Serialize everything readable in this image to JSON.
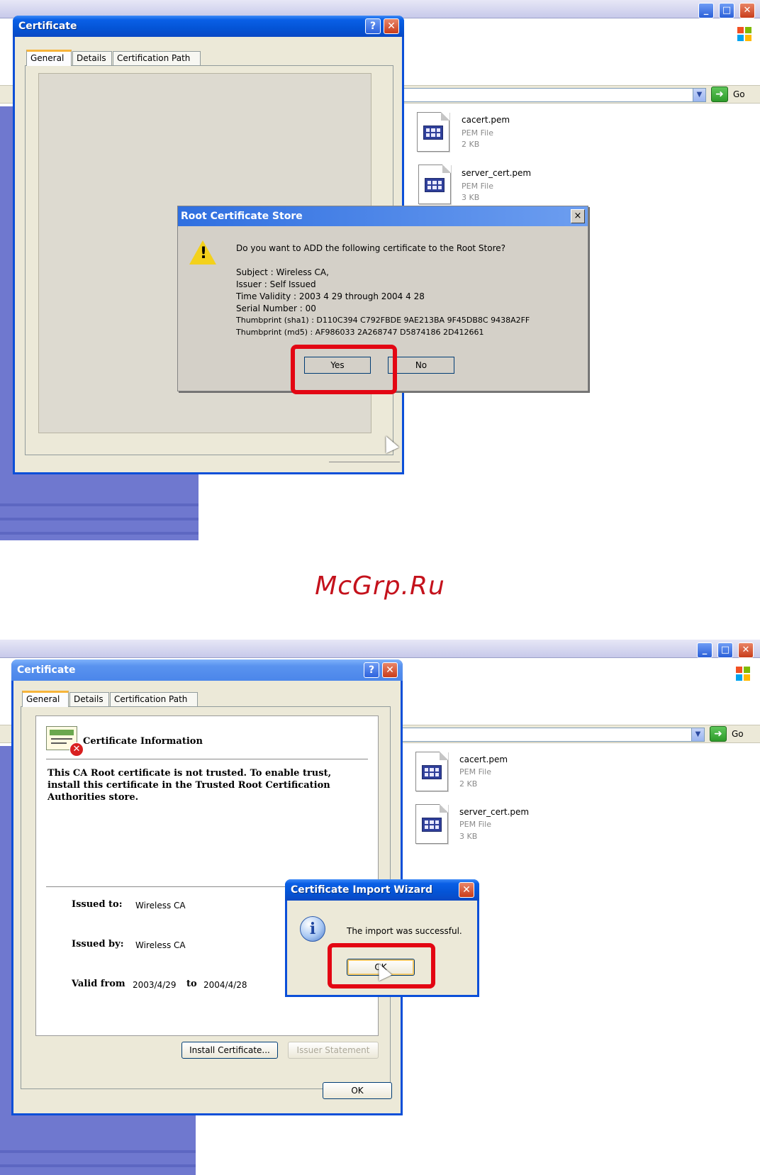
{
  "watermark": "McGrp.Ru",
  "screen1": {
    "window_title": "Certificate",
    "tabs": [
      "General",
      "Details",
      "Certification Path"
    ],
    "go_label": "Go",
    "files": [
      {
        "name": "cacert.pem",
        "type": "PEM File",
        "size": "2 KB"
      },
      {
        "name": "server_cert.pem",
        "type": "PEM File",
        "size": "3 KB"
      }
    ],
    "root_dialog": {
      "title": "Root Certificate Store",
      "close": "×",
      "question": "Do you want to ADD the following certificate to the Root Store?",
      "details": [
        "Subject : Wireless CA,",
        "Issuer : Self Issued",
        "Time Validity : 2003   4   29    through 2004   4   28",
        "Serial Number : 00",
        "Thumbprint (sha1) : D110C394 C792FBDE 9AE213BA 9F45DB8C 9438A2FF",
        "Thumbprint (md5) : AF986033 2A268747 D5874186 2D412661"
      ],
      "yes": "Yes",
      "no": "No"
    }
  },
  "screen2": {
    "window_title": "Certificate",
    "tabs": [
      "General",
      "Details",
      "Certification Path"
    ],
    "go_label": "Go",
    "files": [
      {
        "name": "cacert.pem",
        "type": "PEM File",
        "size": "2 KB"
      },
      {
        "name": "server_cert.pem",
        "type": "PEM File",
        "size": "3 KB"
      }
    ],
    "info_heading": "Certificate Information",
    "info_text": "This CA Root certificate is not trusted. To enable trust, install this certificate in the Trusted Root Certification Authorities store.",
    "issued_to_label": "Issued to:",
    "issued_to": "Wireless CA",
    "issued_by_label": "Issued by:",
    "issued_by": "Wireless CA",
    "valid_from_label": "Valid from",
    "valid_from": "2003/4/29",
    "to_label": "to",
    "valid_to": "2004/4/28",
    "install_button": "Install Certificate...",
    "issuer_button": "Issuer Statement",
    "ok_button": "OK",
    "wizard": {
      "title": "Certificate Import Wizard",
      "message": "The import was successful.",
      "ok": "OK"
    }
  },
  "colors": {
    "xp_blue": "#0454d6",
    "highlight_red": "#e30613",
    "watermark_red": "#c4121c"
  }
}
